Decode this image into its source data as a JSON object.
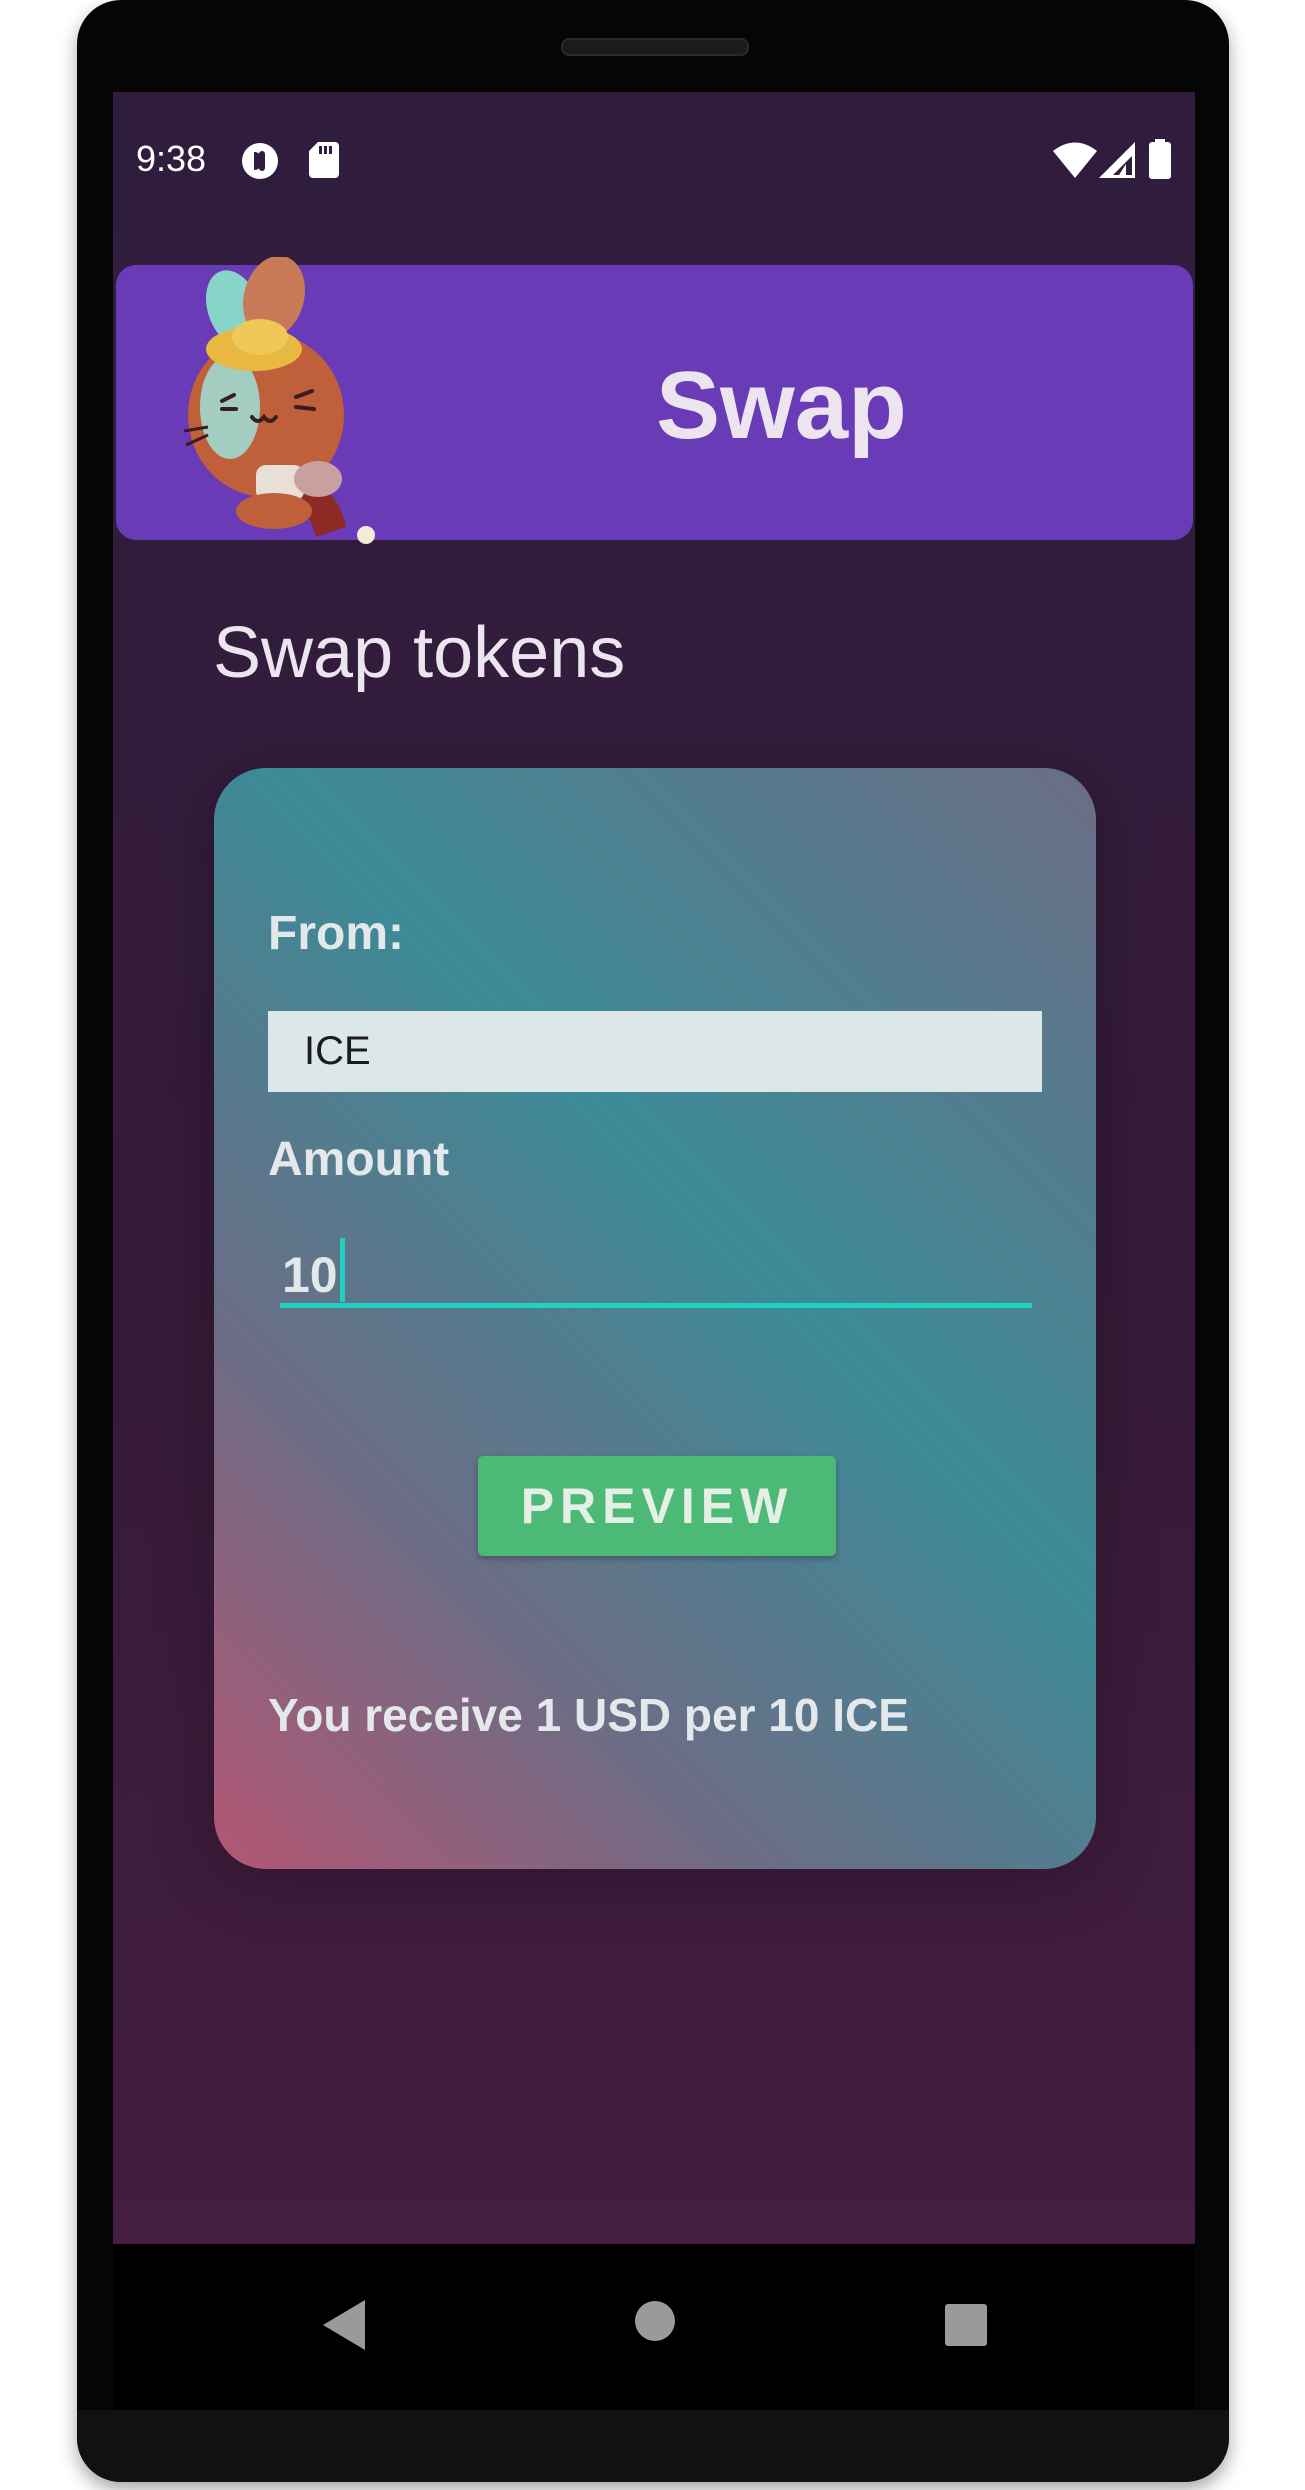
{
  "status_bar": {
    "time": "9:38",
    "left_icons": [
      "pocket-casts-icon",
      "sd-card-icon"
    ],
    "right_icons": [
      "wifi-icon",
      "signal-icon",
      "battery-icon"
    ]
  },
  "app_bar": {
    "title": "Swap",
    "color": "#693bb6",
    "mascot": "bunny-mascot-icon"
  },
  "page": {
    "title": "Swap tokens"
  },
  "form": {
    "from_label": "From:",
    "from_value": "ICE",
    "amount_label": "Amount",
    "amount_value": "10",
    "preview_label": "PREVIEW",
    "rate_text": "You receive 1 USD per 10 ICE"
  },
  "nav_bar": {
    "buttons": [
      "back-icon",
      "home-icon",
      "recents-icon"
    ]
  },
  "colors": {
    "accent": "#1fd1c1",
    "button": "#4cb977",
    "background": "#301d3e"
  }
}
